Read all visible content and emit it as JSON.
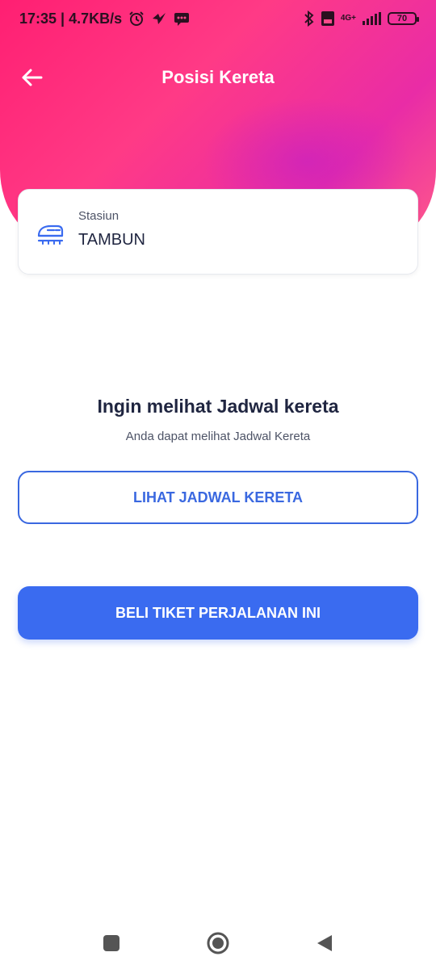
{
  "status_bar": {
    "time_speed": "17:35 | 4.7KB/s",
    "network": "4G+",
    "battery": "70"
  },
  "header": {
    "title": "Posisi Kereta"
  },
  "station_card": {
    "label": "Stasiun",
    "value": "TAMBUN"
  },
  "info": {
    "title": "Ingin melihat Jadwal kereta",
    "subtitle": "Anda dapat melihat Jadwal Kereta"
  },
  "buttons": {
    "view_schedule": "LIHAT JADWAL KERETA",
    "buy_ticket": "BELI TIKET PERJALANAN INI"
  },
  "colors": {
    "accent": "#3a6bf0",
    "header_gradient_start": "#ff1f72",
    "header_gradient_end": "#e92ca6"
  }
}
